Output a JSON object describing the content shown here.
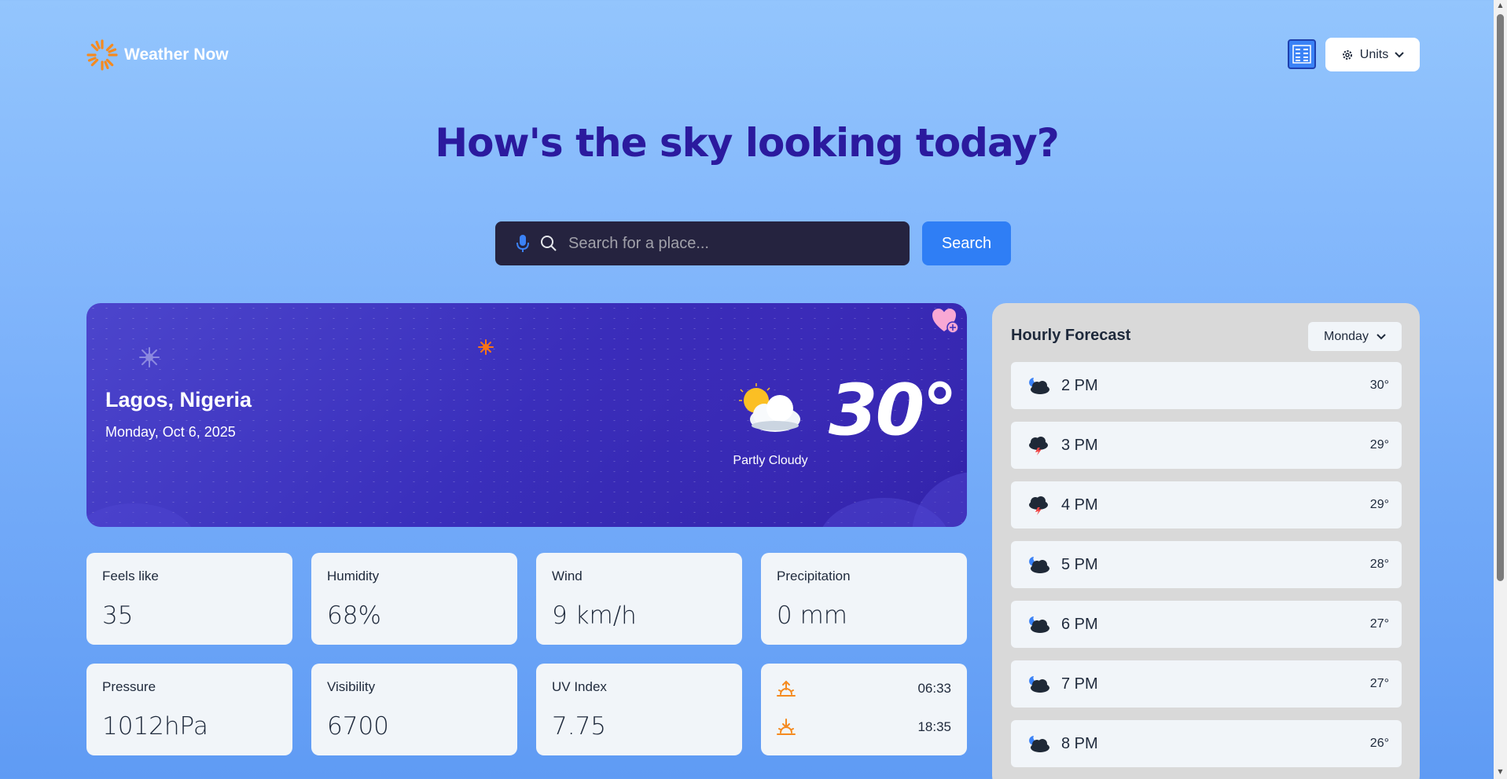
{
  "app": {
    "name": "Weather Now"
  },
  "header": {
    "units_label": "Units"
  },
  "hero": {
    "title": "How's the sky looking today?"
  },
  "search": {
    "placeholder": "Search for a place...",
    "button_label": "Search"
  },
  "current": {
    "location": "Lagos, Nigeria",
    "date": "Monday, Oct 6, 2025",
    "condition": "Partly Cloudy",
    "temperature": "30°",
    "icon": "partly-cloudy-icon"
  },
  "stats": [
    {
      "label": "Feels like",
      "value": "35"
    },
    {
      "label": "Humidity",
      "value": "68%"
    },
    {
      "label": "Wind",
      "value": "9 km/h"
    },
    {
      "label": "Precipitation",
      "value": "0 mm"
    },
    {
      "label": "Pressure",
      "value": "1012hPa"
    },
    {
      "label": "Visibility",
      "value": "6700"
    },
    {
      "label": "UV Index",
      "value": "7.75"
    }
  ],
  "sun": {
    "sunrise": "06:33",
    "sunset": "18:35"
  },
  "hourly": {
    "title": "Hourly Forecast",
    "selected_day": "Monday",
    "items": [
      {
        "time": "2 PM",
        "temp": "30°",
        "icon": "night-cloudy-icon"
      },
      {
        "time": "3 PM",
        "temp": "29°",
        "icon": "thunder-cloud-icon"
      },
      {
        "time": "4 PM",
        "temp": "29°",
        "icon": "thunder-cloud-icon"
      },
      {
        "time": "5 PM",
        "temp": "28°",
        "icon": "night-cloudy-icon"
      },
      {
        "time": "6 PM",
        "temp": "27°",
        "icon": "night-cloudy-icon"
      },
      {
        "time": "7 PM",
        "temp": "27°",
        "icon": "night-cloudy-icon"
      },
      {
        "time": "8 PM",
        "temp": "26°",
        "icon": "night-cloudy-icon"
      }
    ]
  },
  "colors": {
    "accent": "#2f7ef5",
    "title": "#2b1a9e",
    "card": "#3a2fbc",
    "sun_orange": "#f59e0b"
  }
}
